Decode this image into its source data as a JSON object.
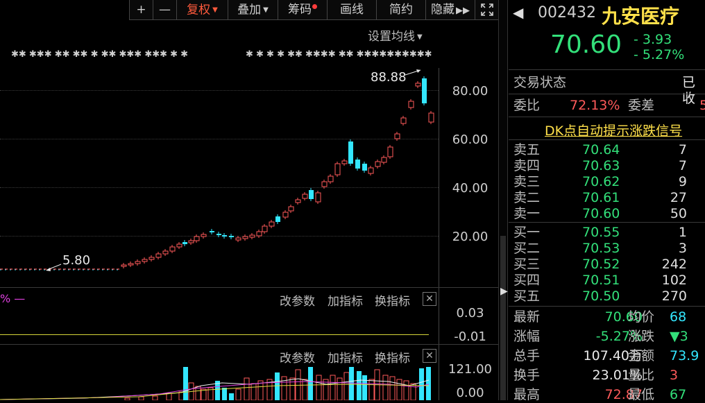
{
  "toolbar": {
    "plus_label": "+",
    "minus_label": "—",
    "fuquan_label": "复权",
    "diejia_label": "叠加",
    "chouma_label": "筹码",
    "huaxian_label": "画线",
    "jianyue_label": "简约",
    "yincang_label": "隐藏",
    "forward_icon": "double-chevron-right-icon",
    "fullscreen_icon": "fullscreen-icon"
  },
  "main_chart": {
    "ma_settings_label": "设置均线",
    "high_label": "88.88",
    "low_label": "5.80",
    "y_ticks": [
      "80.00",
      "60.00",
      "40.00",
      "20.00"
    ]
  },
  "indicator_panel_1": {
    "left_label": "% —",
    "change_params": "改参数",
    "add_indicator": "加指标",
    "switch_indicator": "换指标",
    "close": "✕",
    "y_ticks": [
      "0.03",
      "-0.01"
    ]
  },
  "indicator_panel_2": {
    "change_params": "改参数",
    "add_indicator": "加指标",
    "switch_indicator": "换指标",
    "close": "✕",
    "y_ticks": [
      "121.00",
      "0.00"
    ]
  },
  "quote": {
    "code": "002432",
    "name": "九安医疗",
    "price": "70.60",
    "change": "- 3.93",
    "change_pct": "- 5.27%",
    "status_label": "交易状态",
    "status_value": "已收",
    "weibi_label": "委比",
    "weibi_value": "72.13%",
    "weicha_label": "委差",
    "weicha_value": "5",
    "dk_link": "DK点自动提示涨跌信号",
    "sell": [
      {
        "label": "卖五",
        "price": "70.64",
        "vol": "7"
      },
      {
        "label": "卖四",
        "price": "70.63",
        "vol": "7"
      },
      {
        "label": "卖三",
        "price": "70.62",
        "vol": "9"
      },
      {
        "label": "卖二",
        "price": "70.61",
        "vol": "27"
      },
      {
        "label": "卖一",
        "price": "70.60",
        "vol": "50"
      }
    ],
    "buy": [
      {
        "label": "买一",
        "price": "70.55",
        "vol": "1"
      },
      {
        "label": "买二",
        "price": "70.53",
        "vol": "3"
      },
      {
        "label": "买三",
        "price": "70.52",
        "vol": "242"
      },
      {
        "label": "买四",
        "price": "70.51",
        "vol": "102"
      },
      {
        "label": "买五",
        "price": "70.50",
        "vol": "270"
      }
    ],
    "stats": [
      {
        "l1": "最新",
        "v1": "70.60",
        "l2": "均价",
        "v2": "68"
      },
      {
        "l1": "涨幅",
        "v1": "-5.27%",
        "l2": "涨跌",
        "v2": "▼3"
      },
      {
        "l1": "总手",
        "v1": "107.40万",
        "l2": "金额",
        "v2": "73.9"
      },
      {
        "l1": "换手",
        "v1": "23.01%",
        "l2": "量比",
        "v2": "3"
      },
      {
        "l1": "最高",
        "v1": "72.87",
        "l2": "最低",
        "v2": "67"
      }
    ]
  },
  "colors": {
    "up": "#ff5a5a",
    "down": "#33e6ff",
    "green": "#33e07a",
    "accent": "#ff5a3c",
    "bg": "#000000"
  }
}
